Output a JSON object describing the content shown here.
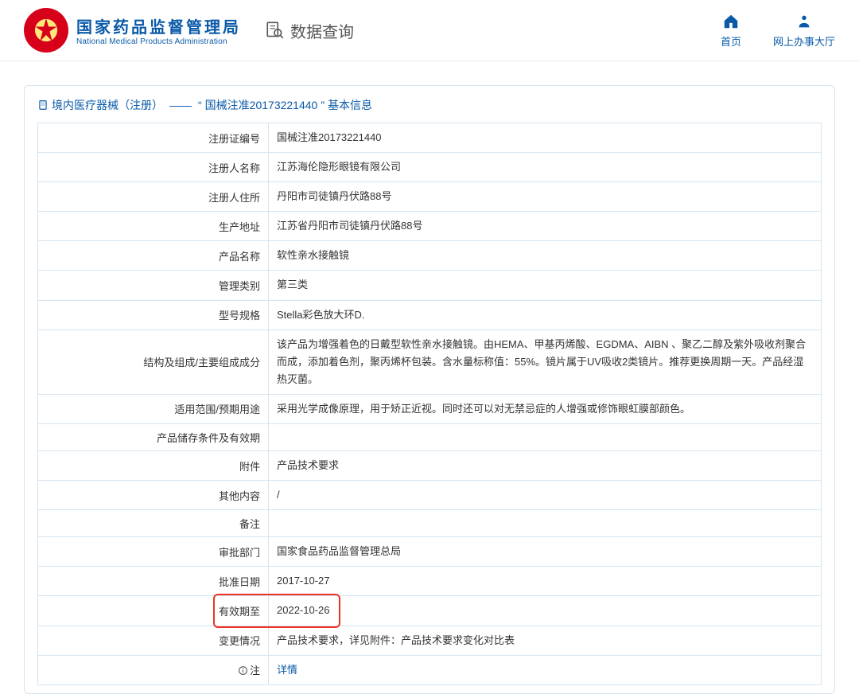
{
  "header": {
    "org_cn": "国家药品监督管理局",
    "org_en": "National Medical Products Administration",
    "page_title": "数据查询"
  },
  "nav": {
    "home": "首页",
    "hall": "网上办事大厅"
  },
  "breadcrumb": {
    "cat": "境内医疗器械（注册）",
    "sep": "——",
    "quote_open": "“",
    "reg": "国械注准20173221440",
    "quote_close": "”",
    "tail": "基本信息"
  },
  "rows": [
    {
      "label": "注册证编号",
      "value": "国械注准20173221440"
    },
    {
      "label": "注册人名称",
      "value": "江苏海伦隐形眼镜有限公司"
    },
    {
      "label": "注册人住所",
      "value": "丹阳市司徒镇丹伏路88号"
    },
    {
      "label": "生产地址",
      "value": "江苏省丹阳市司徒镇丹伏路88号"
    },
    {
      "label": "产品名称",
      "value": "软性亲水接触镜"
    },
    {
      "label": "管理类别",
      "value": "第三类"
    },
    {
      "label": "型号规格",
      "value": "Stella彩色放大环D."
    },
    {
      "label": "结构及组成/主要组成成分",
      "value": "该产品为增强着色的日戴型软性亲水接触镜。由HEMA、甲基丙烯酸、EGDMA、AIBN 、聚乙二醇及紫外吸收剂聚合而成，添加着色剂，聚丙烯杯包装。含水量标称值：55%。镜片属于UV吸收2类镜片。推荐更换周期一天。产品经湿热灭菌。"
    },
    {
      "label": "适用范围/预期用途",
      "value": "采用光学成像原理，用于矫正近视。同时还可以对无禁忌症的人增强或修饰眼虹膜部颜色。"
    },
    {
      "label": "产品储存条件及有效期",
      "value": ""
    },
    {
      "label": "附件",
      "value": "产品技术要求"
    },
    {
      "label": "其他内容",
      "value": "/"
    },
    {
      "label": "备注",
      "value": ""
    },
    {
      "label": "审批部门",
      "value": "国家食品药品监督管理总局"
    },
    {
      "label": "批准日期",
      "value": "2017-10-27"
    },
    {
      "label": "有效期至",
      "value": "2022-10-26"
    },
    {
      "label": "变更情况",
      "value": "产品技术要求，详见附件：产品技术要求变化对比表"
    }
  ],
  "note_row": {
    "label": "注",
    "value": "详情"
  }
}
